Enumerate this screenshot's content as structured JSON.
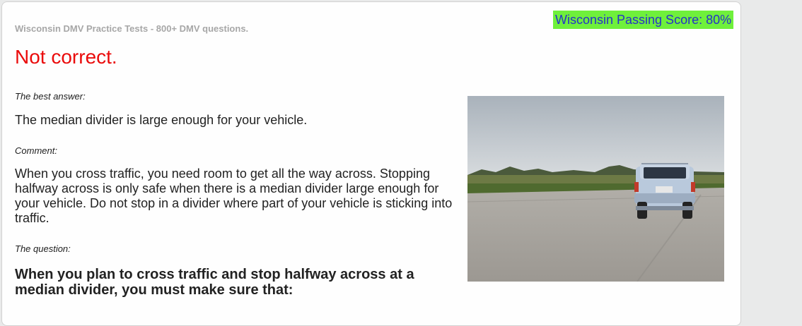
{
  "header": {
    "subtitle": "Wisconsin DMV Practice Tests - 800+ DMV questions.",
    "passing_score": "Wisconsin Passing Score: 80%"
  },
  "result": {
    "verdict": "Not correct."
  },
  "answer": {
    "label": "The best answer:",
    "text": "The median divider is large enough for your vehicle."
  },
  "comment": {
    "label": "Comment:",
    "text": "When you cross traffic, you need room to get all the way across. Stopping halfway across is only safe when there is a median divider large enough for your vehicle. Do not stop in a divider where part of your vehicle is sticking into traffic."
  },
  "question": {
    "label": "The question:",
    "text": "When you plan to cross traffic and stop halfway across at a median divider, you must make sure that:"
  },
  "colors": {
    "verdict": "#ea0b0b",
    "passing_bg": "#6ff03b",
    "passing_text": "#2532c9"
  },
  "image": {
    "description_icon": "suv-crossing-road-photo"
  }
}
